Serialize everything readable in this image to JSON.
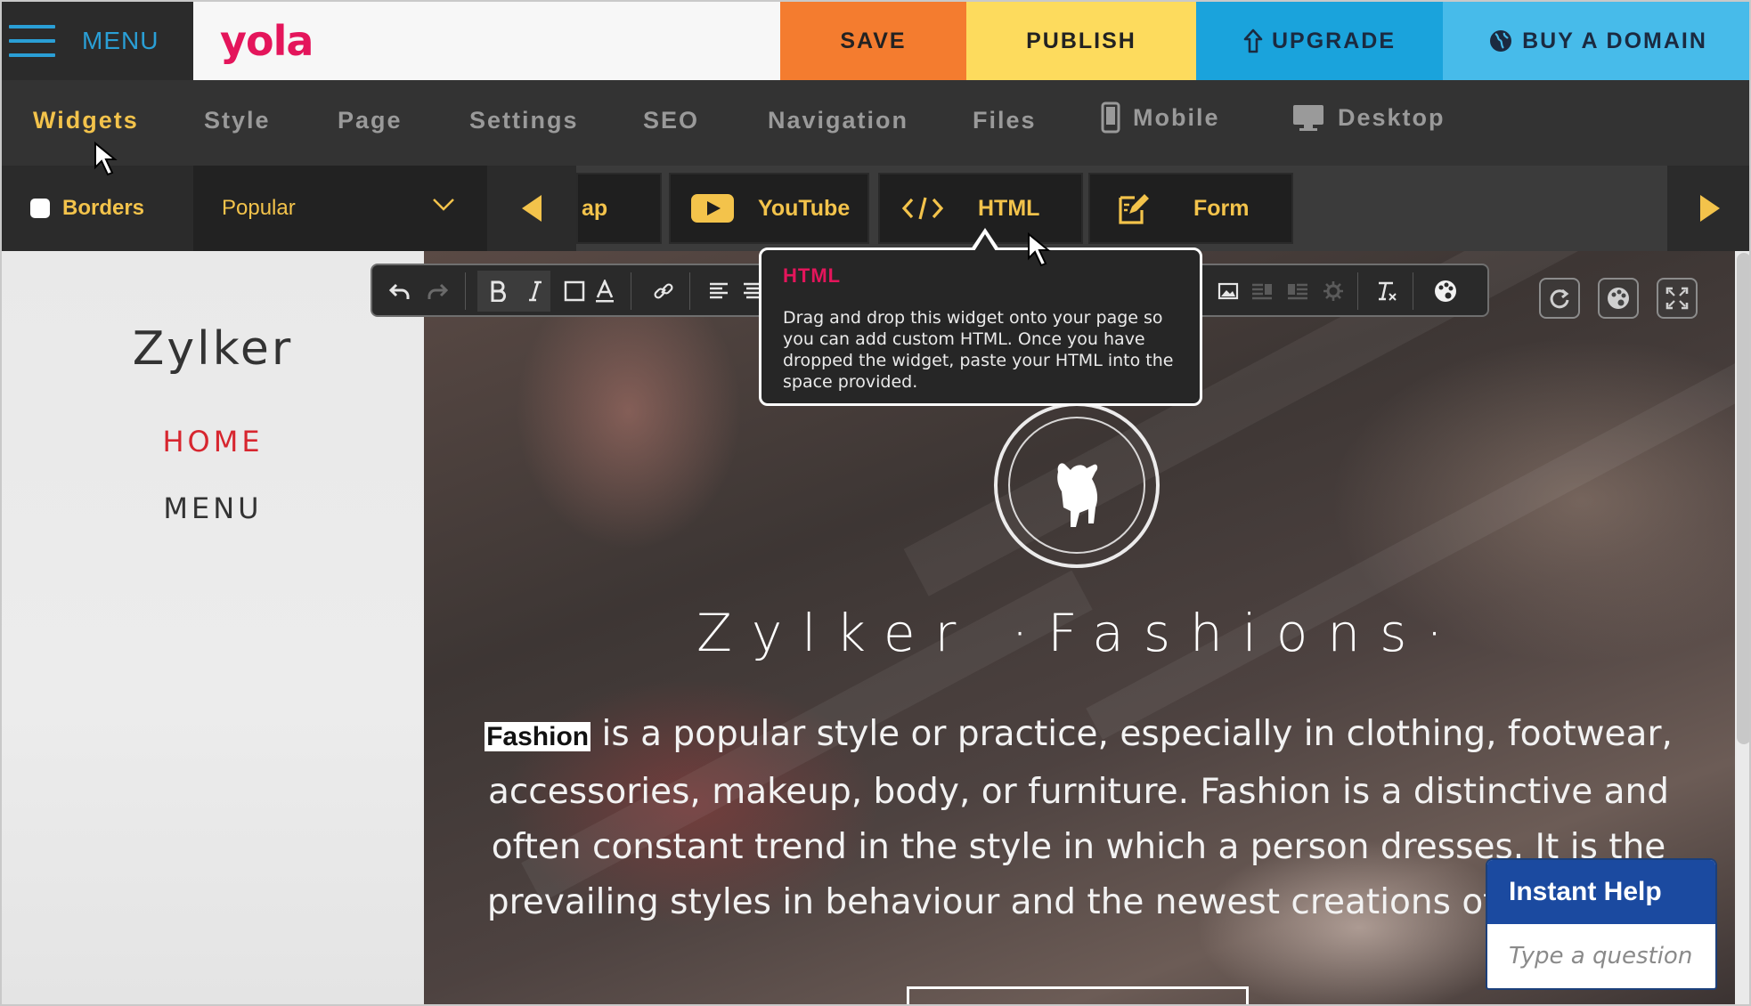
{
  "topbar": {
    "menu_label": "MENU",
    "logo": "yola",
    "save": "SAVE",
    "publish": "PUBLISH",
    "upgrade": "UPGRADE",
    "buy_domain": "BUY A DOMAIN"
  },
  "nav": {
    "tabs": [
      {
        "label": "Widgets"
      },
      {
        "label": "Style"
      },
      {
        "label": "Page"
      },
      {
        "label": "Settings"
      },
      {
        "label": "SEO"
      },
      {
        "label": "Navigation"
      },
      {
        "label": "Files"
      },
      {
        "label": "Mobile"
      },
      {
        "label": "Desktop"
      }
    ],
    "active": "Widgets"
  },
  "widgetbar": {
    "borders_label": "Borders",
    "category": "Popular",
    "items": [
      {
        "label": "ap"
      },
      {
        "label": "YouTube"
      },
      {
        "label": "HTML"
      },
      {
        "label": "Form"
      }
    ]
  },
  "tooltip": {
    "title": "HTML",
    "body": "Drag and drop this widget onto your page so you can add custom HTML. Once you have dropped the widget, paste your HTML into the space provided."
  },
  "site": {
    "title": "Zylker",
    "nav": [
      "HOME",
      "MENU"
    ],
    "hero_title": "Zylker ·Fashions·",
    "hero_highlight": "Fashion",
    "hero_text": " is a popular style or practice, especially in clothing, footwear, accessories, makeup, body, or furniture. Fashion is a distinctive and often constant trend in the style in which a person dresses. It is the prevailing styles in behaviour and the newest creations of textile de"
  },
  "help": {
    "title": "Instant Help",
    "placeholder": "Type a question"
  },
  "colors": {
    "accent_yellow": "#f3c34b",
    "brand_pink": "#e4155b",
    "save": "#f47c2f",
    "publish": "#fddb5d",
    "upgrade": "#1aa3dc",
    "domain": "#47bbea"
  }
}
